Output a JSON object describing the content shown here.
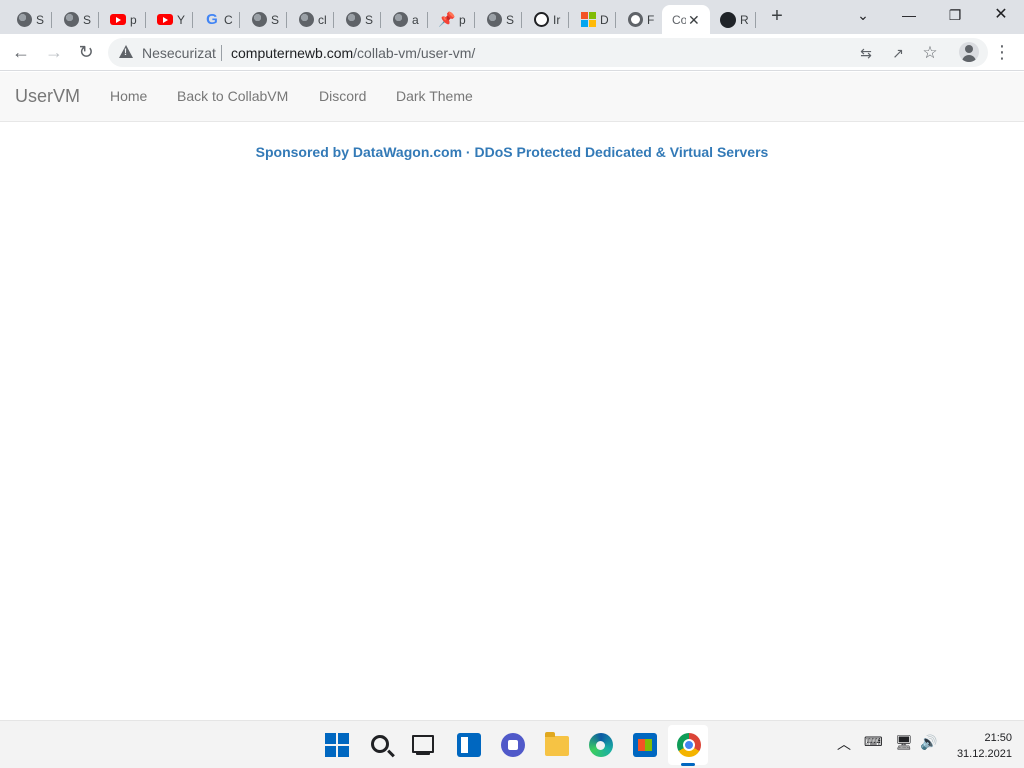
{
  "browser": {
    "tabs": [
      {
        "label": "S",
        "icon": "globe-icon"
      },
      {
        "label": "S",
        "icon": "globe-icon"
      },
      {
        "label": "p",
        "icon": "youtube-icon"
      },
      {
        "label": "Y",
        "icon": "youtube-icon"
      },
      {
        "label": "C",
        "icon": "google-icon"
      },
      {
        "label": "S",
        "icon": "globe-icon"
      },
      {
        "label": "cl",
        "icon": "globe-icon"
      },
      {
        "label": "S",
        "icon": "globe-icon"
      },
      {
        "label": "a",
        "icon": "globe-icon"
      },
      {
        "label": "p",
        "icon": "pin-icon"
      },
      {
        "label": "S",
        "icon": "globe-icon"
      },
      {
        "label": "Ir",
        "icon": "extension-icon"
      },
      {
        "label": "D",
        "icon": "microsoft-icon"
      },
      {
        "label": "F",
        "icon": "chrome-icon"
      },
      {
        "label": "Co",
        "icon": "none",
        "active": true,
        "close": "✕"
      },
      {
        "label": "R",
        "icon": "github-icon"
      }
    ],
    "new_tab": "+",
    "window_controls": {
      "tab_search": "⌄",
      "minimize": "—",
      "restore": "❐",
      "close": "✕"
    },
    "toolbar": {
      "back": "←",
      "forward": "→",
      "reload": "↻",
      "menu": "⋮"
    },
    "address": {
      "security_label": "Nesecurizat",
      "domain": "computernewb.com",
      "path": "/collab-vm/user-vm/"
    }
  },
  "site": {
    "brand": "UserVM",
    "nav": [
      "Home",
      "Back to CollabVM",
      "Discord",
      "Dark Theme"
    ],
    "sponsor": "Sponsored by DataWagon.com · DDoS Protected Dedicated & Virtual Servers",
    "colors": {
      "link": "#337ab7",
      "nav_text": "#777777",
      "navbar_bg": "#f8f8f8"
    }
  },
  "taskbar": {
    "clock_time": "21:50",
    "clock_date": "31.12.2021",
    "accent": "#0067c0"
  }
}
